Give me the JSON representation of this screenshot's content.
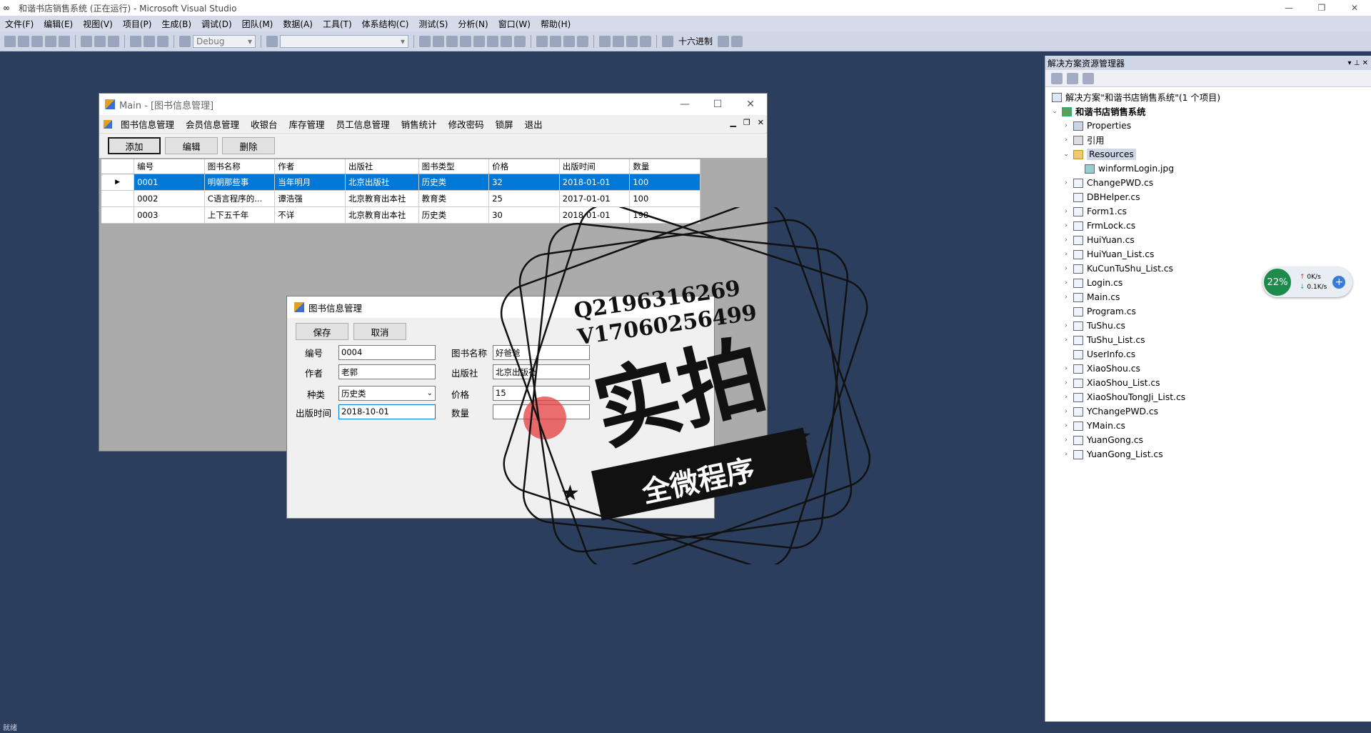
{
  "vs": {
    "title": "和谐书店销售系统 (正在运行) - Microsoft Visual Studio",
    "menu": [
      "文件(F)",
      "编辑(E)",
      "视图(V)",
      "项目(P)",
      "生成(B)",
      "调试(D)",
      "团队(M)",
      "数据(A)",
      "工具(T)",
      "体系结构(C)",
      "测试(S)",
      "分析(N)",
      "窗口(W)",
      "帮助(H)"
    ],
    "config": "Debug",
    "hex_label": "十六进制",
    "status": "就绪"
  },
  "main": {
    "title": "Main - [图书信息管理]",
    "menu": [
      "图书信息管理",
      "会员信息管理",
      "收银台",
      "库存管理",
      "员工信息管理",
      "销售统计",
      "修改密码",
      "锁屏",
      "退出"
    ],
    "buttons": {
      "add": "添加",
      "edit": "编辑",
      "delete": "删除"
    },
    "columns": [
      "编号",
      "图书名称",
      "作者",
      "出版社",
      "图书类型",
      "价格",
      "出版时间",
      "数量"
    ],
    "rows": [
      [
        "0001",
        "明朝那些事",
        "当年明月",
        "北京出版社",
        "历史类",
        "32",
        "2018-01-01",
        "100"
      ],
      [
        "0002",
        "C语言程序的...",
        "谭浩强",
        "北京教育出本社",
        "教育类",
        "25",
        "2017-01-01",
        "100"
      ],
      [
        "0003",
        "上下五千年",
        "不详",
        "北京教育出本社",
        "历史类",
        "30",
        "2018-01-01",
        "198"
      ]
    ],
    "selected_row_marker": "▶"
  },
  "dialog": {
    "title": "图书信息管理",
    "save": "保存",
    "cancel": "取消",
    "labels": {
      "id": "编号",
      "name": "图书名称",
      "author": "作者",
      "publisher": "出版社",
      "category": "种类",
      "price": "价格",
      "pubdate": "出版时间",
      "quantity": "数量"
    },
    "values": {
      "id": "0004",
      "name": "好爸爸",
      "author": "老郭",
      "publisher": "北京出版社",
      "category": "历史类",
      "price": "15",
      "pubdate": "2018-10-01",
      "quantity": ""
    }
  },
  "solution": {
    "title": "解决方案资源管理器",
    "root": "解决方案\"和谐书店销售系统\"(1 个项目)",
    "project": "和谐书店销售系统",
    "items": [
      {
        "label": "Properties",
        "icon": "prop",
        "indent": 2,
        "arrow": "›"
      },
      {
        "label": "引用",
        "icon": "ref",
        "indent": 2,
        "arrow": "›"
      },
      {
        "label": "Resources",
        "icon": "folder",
        "indent": 2,
        "arrow": "⌄",
        "hl": true
      },
      {
        "label": "winformLogin.jpg",
        "icon": "img",
        "indent": 3,
        "arrow": ""
      },
      {
        "label": "ChangePWD.cs",
        "icon": "cs",
        "indent": 2,
        "arrow": "›"
      },
      {
        "label": "DBHelper.cs",
        "icon": "cs",
        "indent": 2,
        "arrow": ""
      },
      {
        "label": "Form1.cs",
        "icon": "cs",
        "indent": 2,
        "arrow": "›"
      },
      {
        "label": "FrmLock.cs",
        "icon": "cs",
        "indent": 2,
        "arrow": "›"
      },
      {
        "label": "HuiYuan.cs",
        "icon": "cs",
        "indent": 2,
        "arrow": "›"
      },
      {
        "label": "HuiYuan_List.cs",
        "icon": "cs",
        "indent": 2,
        "arrow": "›"
      },
      {
        "label": "KuCunTuShu_List.cs",
        "icon": "cs",
        "indent": 2,
        "arrow": "›"
      },
      {
        "label": "Login.cs",
        "icon": "cs",
        "indent": 2,
        "arrow": "›"
      },
      {
        "label": "Main.cs",
        "icon": "cs",
        "indent": 2,
        "arrow": "›"
      },
      {
        "label": "Program.cs",
        "icon": "cs",
        "indent": 2,
        "arrow": ""
      },
      {
        "label": "TuShu.cs",
        "icon": "cs",
        "indent": 2,
        "arrow": "›"
      },
      {
        "label": "TuShu_List.cs",
        "icon": "cs",
        "indent": 2,
        "arrow": "›"
      },
      {
        "label": "UserInfo.cs",
        "icon": "cs",
        "indent": 2,
        "arrow": ""
      },
      {
        "label": "XiaoShou.cs",
        "icon": "cs",
        "indent": 2,
        "arrow": "›"
      },
      {
        "label": "XiaoShou_List.cs",
        "icon": "cs",
        "indent": 2,
        "arrow": "›"
      },
      {
        "label": "XiaoShouTongJi_List.cs",
        "icon": "cs",
        "indent": 2,
        "arrow": "›"
      },
      {
        "label": "YChangePWD.cs",
        "icon": "cs",
        "indent": 2,
        "arrow": "›"
      },
      {
        "label": "YMain.cs",
        "icon": "cs",
        "indent": 2,
        "arrow": "›"
      },
      {
        "label": "YuanGong.cs",
        "icon": "cs",
        "indent": 2,
        "arrow": "›"
      },
      {
        "label": "YuanGong_List.cs",
        "icon": "cs",
        "indent": 2,
        "arrow": "›"
      }
    ]
  },
  "network": {
    "percent": "22%",
    "up": "0K/s",
    "down": "0.1K/s"
  },
  "watermark": {
    "line1": "Q2196316269",
    "line2": "V17060256499",
    "big": "实拍",
    "banner": "全微程序"
  }
}
